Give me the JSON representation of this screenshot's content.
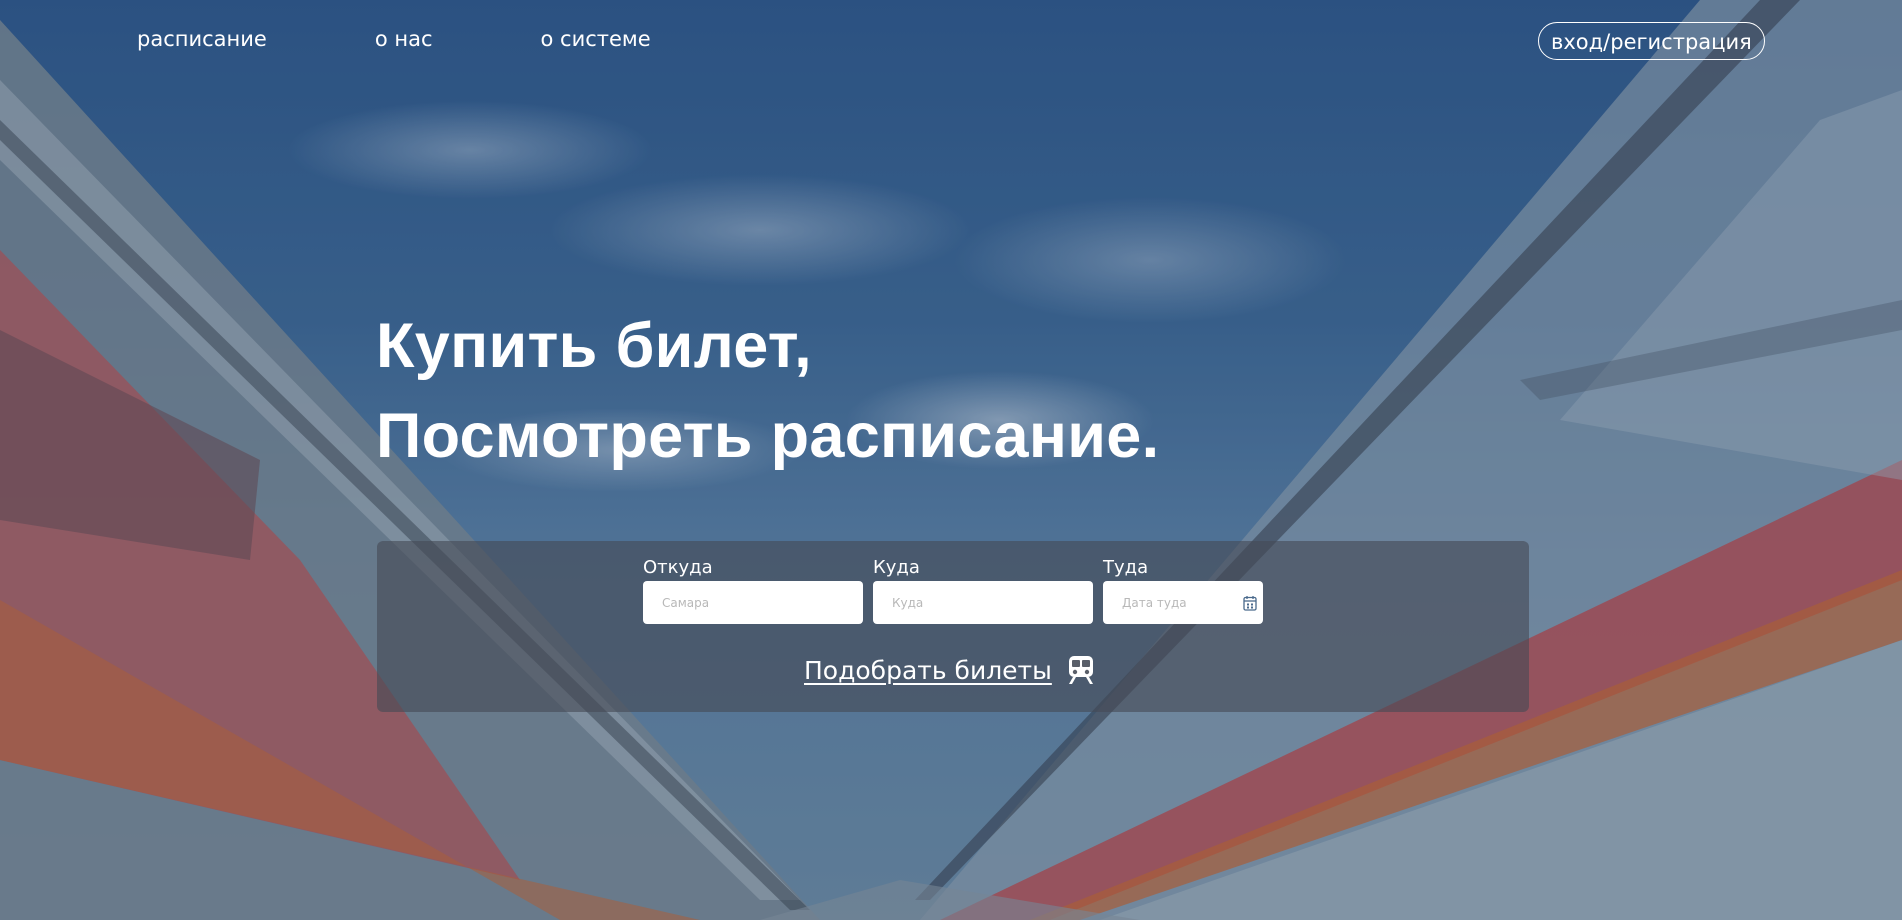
{
  "header": {
    "nav": [
      {
        "label": "расписание"
      },
      {
        "label": "о нас"
      },
      {
        "label": "о системе"
      }
    ],
    "login_label": "вход/регистрация"
  },
  "hero": {
    "line1": "Купить билет,",
    "line2": "Посмотреть расписание."
  },
  "search": {
    "from": {
      "label": "Откуда",
      "placeholder": "Самара",
      "value": ""
    },
    "to": {
      "label": "Куда",
      "placeholder": "Куда",
      "value": ""
    },
    "date": {
      "label": "Туда",
      "placeholder": "Дата туда",
      "value": "",
      "icon": "calendar-icon"
    },
    "submit_label": "Подобрать билеты",
    "submit_icon": "train-icon"
  },
  "colors": {
    "text": "#ffffff",
    "panel": "#464b55",
    "sky": "#2f5a8e",
    "train_red": "#c0474a",
    "train_orange": "#c86a38"
  }
}
